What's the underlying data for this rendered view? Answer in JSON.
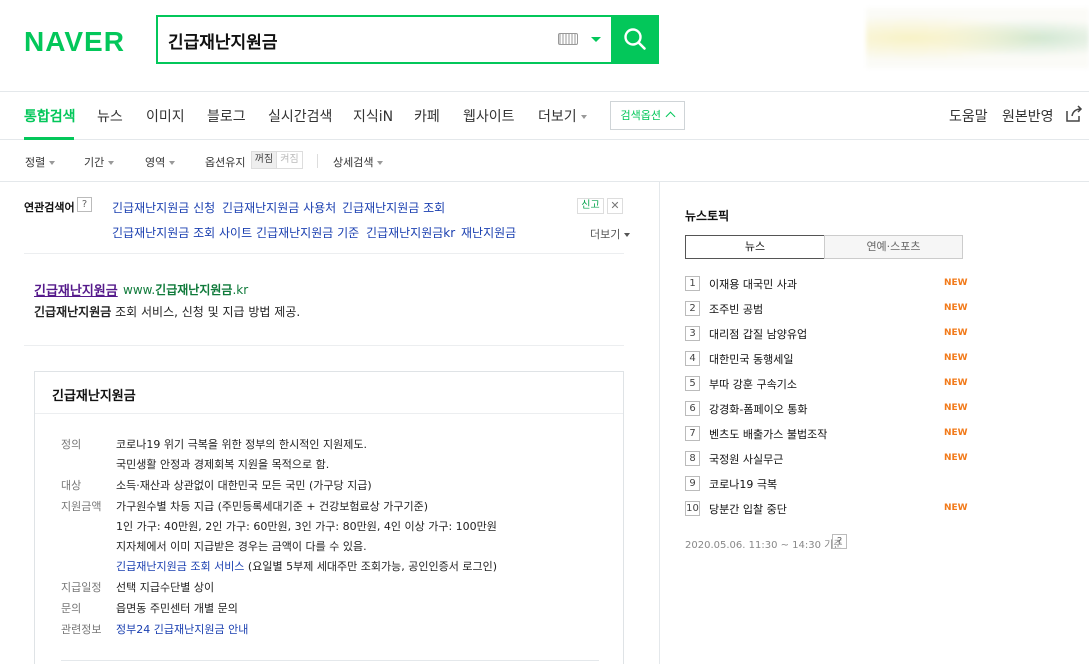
{
  "header": {
    "logo": "NAVER",
    "search_query": "긴급재난지원금",
    "search_button_icon": "search-icon",
    "keyboard_icon": "keyboard-icon"
  },
  "tabs": {
    "items": [
      "통합검색",
      "뉴스",
      "이미지",
      "블로그",
      "실시간검색",
      "지식iN",
      "카페",
      "웹사이트",
      "더보기"
    ],
    "active": "통합검색",
    "search_options": "검색옵션",
    "help": "도움말",
    "feedback": "원본반영"
  },
  "filters": {
    "sort": "정렬",
    "period": "기간",
    "area": "영역",
    "keep_options": "옵션유지",
    "off": "꺼짐",
    "on": "켜짐",
    "detail": "상세검색"
  },
  "related": {
    "title": "연관검색어",
    "help": "?",
    "keywords": [
      "긴급재난지원금 신청",
      "긴급재난지원금 사용처",
      "긴급재난지원금 조회",
      "긴급재난지원금 조회 사이트",
      "긴급재난지원금 기준",
      "긴급재난지원금kr",
      "재난지원금"
    ],
    "report": "신고",
    "close": "✕",
    "more": "더보기"
  },
  "site_result": {
    "title": "긴급재난지원금",
    "url_prefix": "www.",
    "url_bold": "긴급재난지원금",
    "url_suffix": ".kr",
    "desc_bold": "긴급재난지원금",
    "desc_rest": " 조회 서비스, 신청 및 지급 방법 제공."
  },
  "knowledge_box": {
    "title": "긴급재난지원금",
    "labels": {
      "definition": "정의",
      "target": "대상",
      "amount": "지원금액",
      "schedule": "지급일정",
      "inquiry": "문의",
      "related": "관련정보"
    },
    "definition_1": "코로나19 위기 극복을 위한 정부의 한시적인 지원제도.",
    "definition_2": "국민생활 안정과 경제회복 지원을 목적으로 함.",
    "target": "소득·재산과 상관없이 대한민국 모든 국민 (가구당 지급)",
    "amount_1": "가구원수별 차등 지급 (주민등록세대기준 + 건강보험료상 가구기준)",
    "amount_2": "1인 가구: 40만원, 2인 가구: 60만원, 3인 가구: 80만원, 4인 이상 가구: 100만원",
    "amount_3": "지자체에서 이미 지급받은 경우는 금액이 다를 수 있음.",
    "amount_link": "긴급재난지원금 조회 서비스",
    "amount_link_note": " (요일별 5부제 세대주만 조회가능, 공인인증서 로그인)",
    "schedule": "선택 지급수단별 상이",
    "inquiry": "읍면동 주민센터 개별 문의",
    "related_link": "정부24 긴급재난지원금 안내"
  },
  "news_topic": {
    "title": "뉴스토픽",
    "tab_news": "뉴스",
    "tab_ent": "연예·스포츠",
    "items": [
      {
        "num": "1",
        "text": "이재용 대국민 사과",
        "badge": "NEW"
      },
      {
        "num": "2",
        "text": "조주빈 공범",
        "badge": "NEW"
      },
      {
        "num": "3",
        "text": "대리점 갑질 남양유업",
        "badge": "NEW"
      },
      {
        "num": "4",
        "text": "대한민국 동행세일",
        "badge": "NEW"
      },
      {
        "num": "5",
        "text": "부따 강훈 구속기소",
        "badge": "NEW"
      },
      {
        "num": "6",
        "text": "강경화-폼페이오 통화",
        "badge": "NEW"
      },
      {
        "num": "7",
        "text": "벤츠도 배출가스 불법조작",
        "badge": "NEW"
      },
      {
        "num": "8",
        "text": "국정원 사실무근",
        "badge": "NEW"
      },
      {
        "num": "9",
        "text": "코로나19 극복",
        "badge": ""
      },
      {
        "num": "10",
        "text": "당분간 입찰 중단",
        "badge": "NEW"
      }
    ],
    "timestamp": "2020.05.06. 11:30 ~ 14:30 기준",
    "help": "?"
  },
  "colors": {
    "brand": "#03c75a",
    "link": "#1a3fb0",
    "new_badge": "#f27a1a"
  }
}
